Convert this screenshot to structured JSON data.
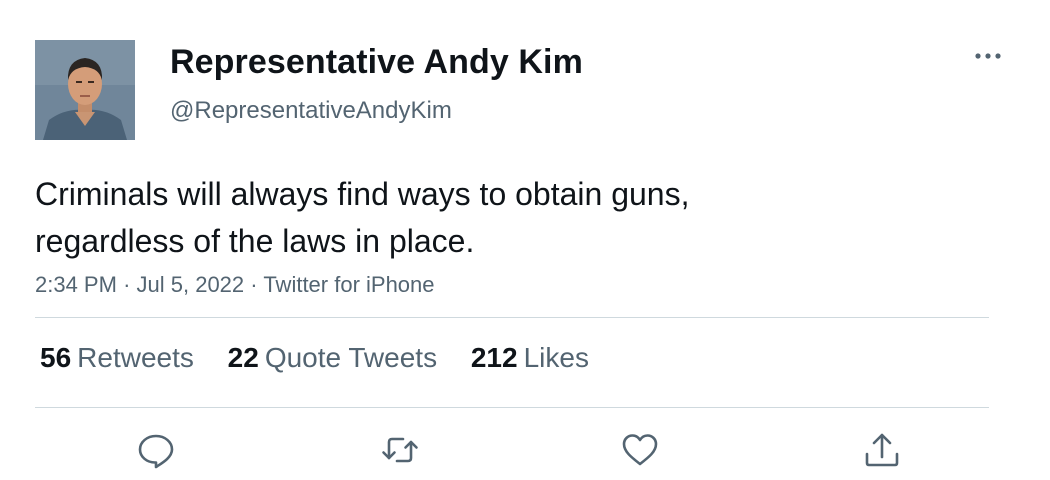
{
  "author": {
    "display_name": "Representative Andy Kim",
    "handle": "@RepresentativeAndyKim"
  },
  "tweet": {
    "lines": [
      "Criminals will always find ways to obtain guns,",
      "regardless of the laws in place."
    ],
    "time": "2:34 PM",
    "separator": "·",
    "date": "Jul 5, 2022",
    "source": "Twitter for iPhone"
  },
  "stats": {
    "retweets": {
      "count": "56",
      "label": "Retweets"
    },
    "quote_tweets": {
      "count": "22",
      "label": "Quote Tweets"
    },
    "likes": {
      "count": "212",
      "label": "Likes"
    }
  },
  "icons": {
    "more": "more-horizontal-icon",
    "reply": "reply-icon",
    "retweet": "retweet-icon",
    "like": "heart-icon",
    "share": "share-icon"
  },
  "colors": {
    "text_primary": "#0f1419",
    "text_secondary": "#536471",
    "divider": "#cfd9de",
    "icon": "#536471"
  }
}
